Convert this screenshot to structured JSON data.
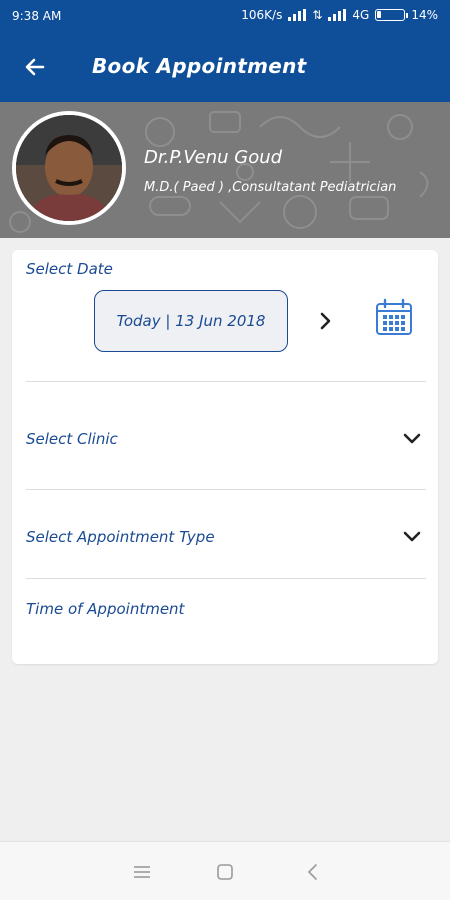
{
  "status_bar": {
    "time": "9:38 AM",
    "net_speed": "106K/s",
    "network": "4G",
    "battery_percent": "14%",
    "battery_level": 0.14
  },
  "app_bar": {
    "title": "Book Appointment",
    "back_icon": "arrow-left-icon"
  },
  "doctor": {
    "name": "Dr.P.Venu Goud",
    "qualification": "M.D.( Paed ) ,Consultatant Pediatrician"
  },
  "form": {
    "select_date_label": "Select Date",
    "date_value": "Today | 13 Jun 2018",
    "select_clinic_label": "Select Clinic",
    "select_appointment_type_label": "Select Appointment Type",
    "time_of_appointment_label": "Time of Appointment"
  },
  "colors": {
    "primary": "#0f4f9a",
    "label_text": "#1a4a93",
    "banner": "#7a7a7a",
    "background": "#efefef"
  },
  "nav": {
    "menu_icon": "menu-icon",
    "home_icon": "square-home-icon",
    "back_icon": "triangle-back-icon"
  }
}
